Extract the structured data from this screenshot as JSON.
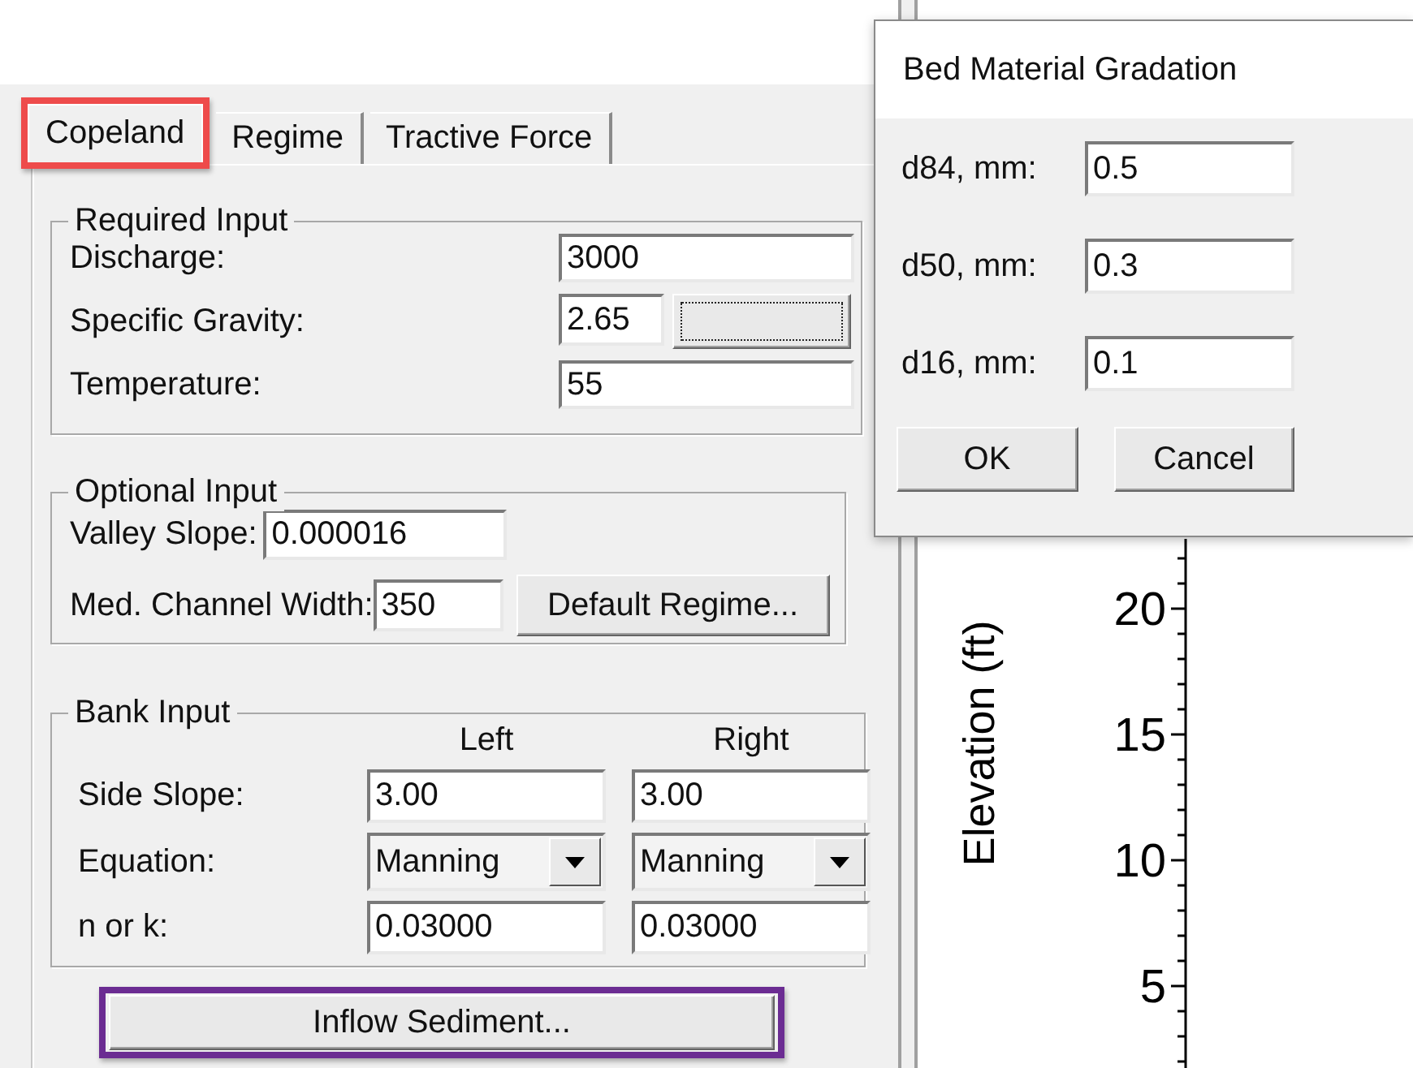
{
  "tabs": [
    {
      "label": "Copeland",
      "selected": true,
      "color": "#ee4b4b"
    },
    {
      "label": "Regime",
      "selected": false
    },
    {
      "label": "Tractive Force",
      "selected": false
    }
  ],
  "required_input": {
    "title": "Required Input",
    "discharge": {
      "label": "Discharge:",
      "value": "3000"
    },
    "specific_gravity": {
      "label": "Specific Gravity:",
      "value": "2.65",
      "button_focused": true
    },
    "temperature": {
      "label": "Temperature:",
      "value": "55"
    }
  },
  "optional_input": {
    "title": "Optional Input",
    "valley_slope": {
      "label": "Valley Slope:",
      "value": "0.000016"
    },
    "channel_width": {
      "label": "Med. Channel Width:",
      "value": "350"
    },
    "button": "Default Regime..."
  },
  "bank_input": {
    "title": "Bank Input",
    "columns": [
      "Left",
      "Right"
    ],
    "rows": [
      {
        "kind": "text",
        "label": "Side Slope:",
        "values": [
          "3.00",
          "3.00"
        ]
      },
      {
        "kind": "dropdown",
        "label": "Equation:",
        "values": [
          "Manning",
          "Manning"
        ]
      },
      {
        "kind": "text",
        "label": "n or k:",
        "values": [
          "0.03000",
          "0.03000"
        ]
      }
    ]
  },
  "inflow_button": {
    "label": "Inflow Sediment...",
    "color": "#6b2c92"
  },
  "chart": {
    "ylabel": "Elevation (ft)",
    "ticks": [
      "20",
      "15",
      "10",
      "5"
    ]
  },
  "dialog": {
    "title": "Bed Material Gradation",
    "fields": [
      {
        "label": "d84, mm:",
        "value": "0.5"
      },
      {
        "label": "d50, mm:",
        "value": "0.3"
      },
      {
        "label": "d16, mm:",
        "value": "0.1"
      }
    ],
    "buttons": [
      "OK",
      "Cancel"
    ]
  }
}
